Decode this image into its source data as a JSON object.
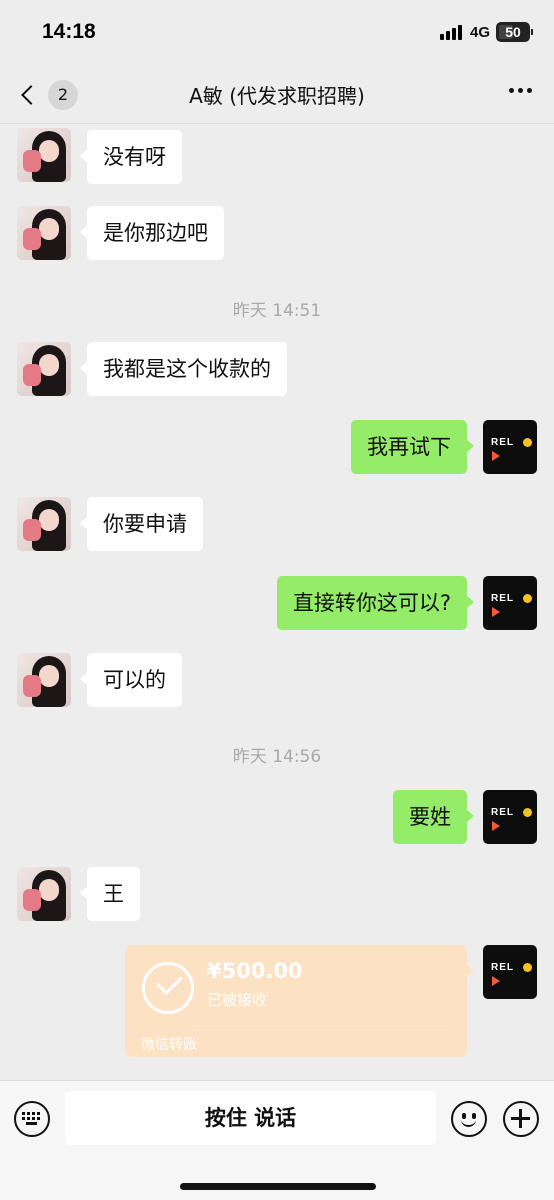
{
  "status_bar": {
    "time": "14:18",
    "network": "4G",
    "battery": "50",
    "battery_level": 0.5
  },
  "header": {
    "back_badge": "2",
    "title": "A敏 (代发求职招聘)",
    "more_icon": "more-dots-icon"
  },
  "messages": [
    {
      "type": "text",
      "side": "left",
      "text": "没有呀"
    },
    {
      "type": "text",
      "side": "left",
      "text": "是你那边吧"
    },
    {
      "type": "time",
      "text": "昨天 14:51"
    },
    {
      "type": "text",
      "side": "left",
      "text": "我都是这个收款的"
    },
    {
      "type": "text",
      "side": "right",
      "text": "我再试下"
    },
    {
      "type": "text",
      "side": "left",
      "text": "你要申请"
    },
    {
      "type": "text",
      "side": "right",
      "text": "直接转你这可以?"
    },
    {
      "type": "text",
      "side": "left",
      "text": "可以的"
    },
    {
      "type": "time",
      "text": "昨天 14:56"
    },
    {
      "type": "text",
      "side": "right",
      "text": "要姓"
    },
    {
      "type": "text",
      "side": "left",
      "text": "王"
    },
    {
      "type": "transfer",
      "side": "right",
      "amount": "¥500.00",
      "status": "已被接收",
      "source": "微信转账"
    }
  ],
  "avatars": {
    "contact_icon": "contact-avatar",
    "self_logo_text": "REL",
    "self_colors": {
      "background": "#0d0d0d",
      "dot": "#f5c320",
      "triangle": "#f05a3a"
    }
  },
  "input_bar": {
    "keyboard_icon": "keyboard-icon",
    "hold_to_talk": "按住 说话",
    "emoji_icon": "emoji-icon",
    "plus_icon": "plus-icon"
  },
  "colors": {
    "bubble_self": "#95ec69",
    "bubble_other": "#ffffff",
    "transfer_card": "#fde1c3",
    "background": "#ededed"
  }
}
